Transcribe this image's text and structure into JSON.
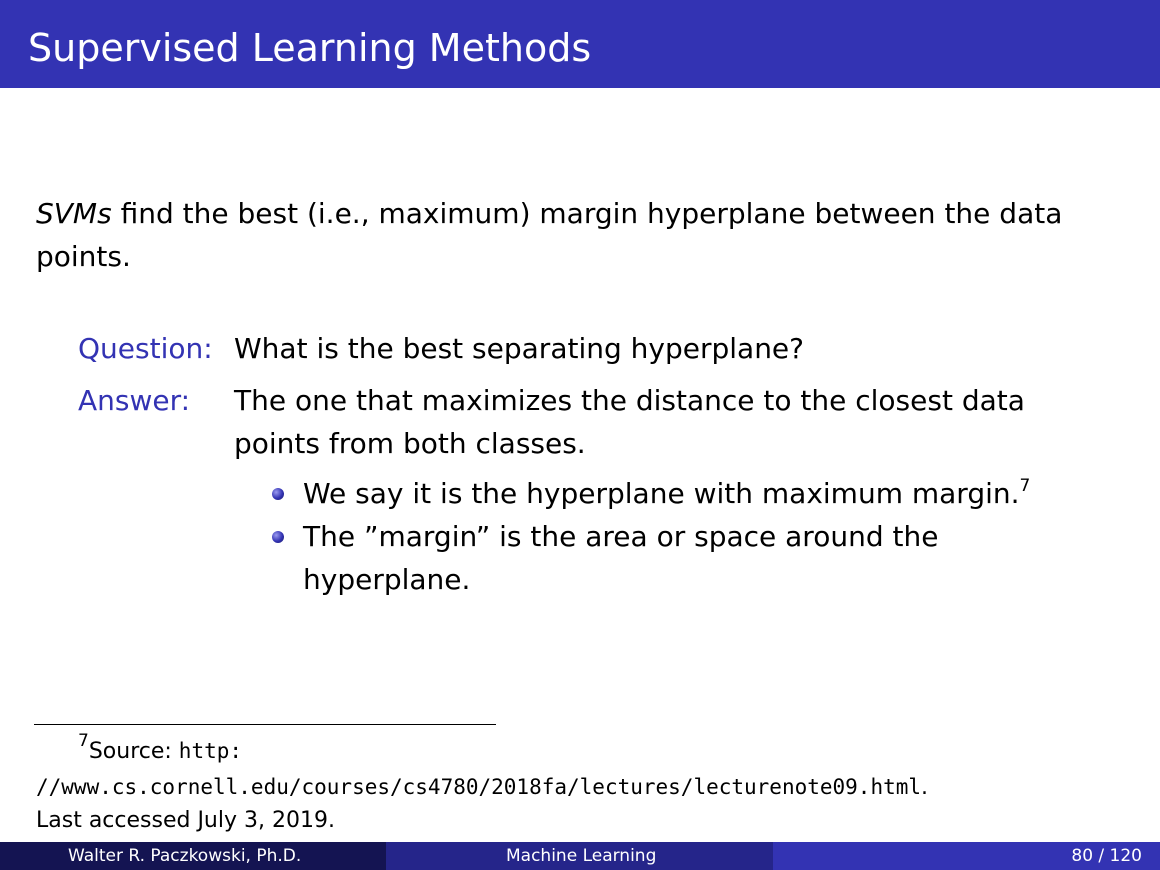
{
  "title": "Supervised Learning Methods",
  "intro": {
    "emphasis": "SVMs",
    "text": " find the best (i.e., maximum) margin hyperplane between the data points."
  },
  "question": {
    "label": "Question:",
    "text": "What is the best separating hyperplane?"
  },
  "answer": {
    "label": "Answer:",
    "text": "The one that maximizes the distance to the closest data points from both classes."
  },
  "bullets": [
    {
      "text": "We say it is the hyperplane with maximum margin.",
      "footnote_mark": "7"
    },
    {
      "text": "The ”margin” is the area or space around the hyperplane."
    }
  ],
  "footnote": {
    "number": "7",
    "prefix": "Source: ",
    "url_part1": "http:",
    "url_part2": "//www.cs.cornell.edu/courses/cs4780/2018fa/lectures/lecturenote09.html",
    "url_suffix": ".",
    "last_line": "Last accessed July 3, 2019."
  },
  "footer": {
    "author": "Walter R. Paczkowski, Ph.D.",
    "course": "Machine Learning",
    "page": "80 / 120"
  },
  "colors": {
    "theme": "#3333b3",
    "footer_dark": "#141452",
    "footer_mid": "#25258a"
  }
}
